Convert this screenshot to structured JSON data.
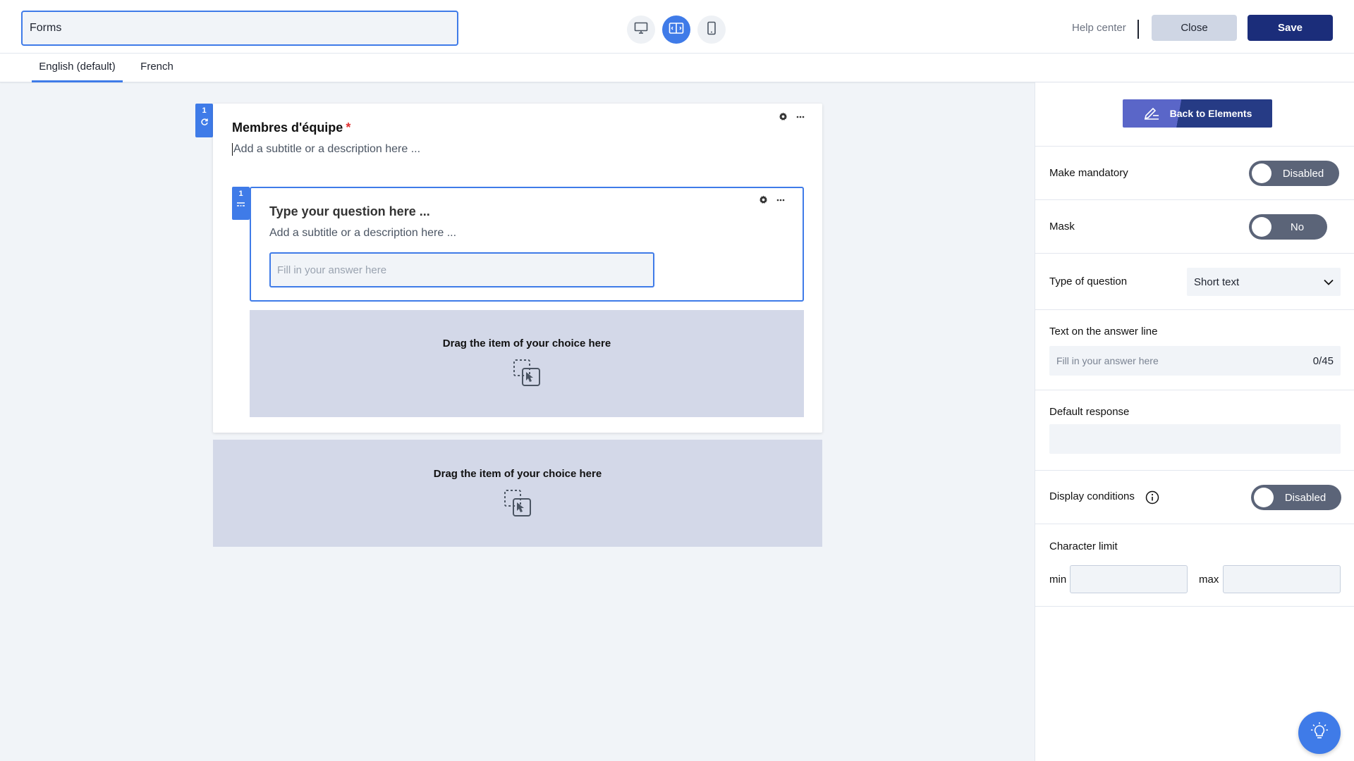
{
  "header": {
    "form_title": "Forms",
    "help_label": "Help center",
    "close_label": "Close",
    "save_label": "Save",
    "views": [
      "desktop-icon",
      "split-view-icon",
      "mobile-icon"
    ],
    "active_view": "split-view-icon"
  },
  "languages": {
    "tabs": [
      {
        "label": "English (default)",
        "active": true
      },
      {
        "label": "French",
        "active": false
      }
    ]
  },
  "canvas": {
    "section": {
      "number": "1",
      "title": "Membres d'équipe",
      "required_mark": "*",
      "subtitle_placeholder": "Add a subtitle or a description here ...",
      "question": {
        "number": "1",
        "title_placeholder": "Type your question here ...",
        "subtitle_placeholder": "Add a subtitle or a description here ...",
        "answer_placeholder": "Fill in your answer here"
      },
      "inner_dropzone": "Drag the item of your choice here"
    },
    "outer_dropzone": "Drag the item of your choice here"
  },
  "panel": {
    "back_label": "Back to Elements",
    "mandatory": {
      "label": "Make mandatory",
      "state": "Disabled"
    },
    "mask": {
      "label": "Mask",
      "state": "No"
    },
    "question_type": {
      "label": "Type of question",
      "value": "Short text"
    },
    "answer_line": {
      "label": "Text on the answer line",
      "placeholder": "Fill in your answer here",
      "counter": "0/45"
    },
    "default_response": {
      "label": "Default response",
      "value": ""
    },
    "display_conditions": {
      "label": "Display conditions",
      "state": "Disabled"
    },
    "char_limit": {
      "label": "Character limit",
      "min_label": "min",
      "max_label": "max"
    }
  },
  "colors": {
    "accent": "#3f7be8",
    "save": "#1b2d7a",
    "toggle_off": "#5b6478",
    "dropzone": "#d3d8e8",
    "required": "#e03131"
  }
}
